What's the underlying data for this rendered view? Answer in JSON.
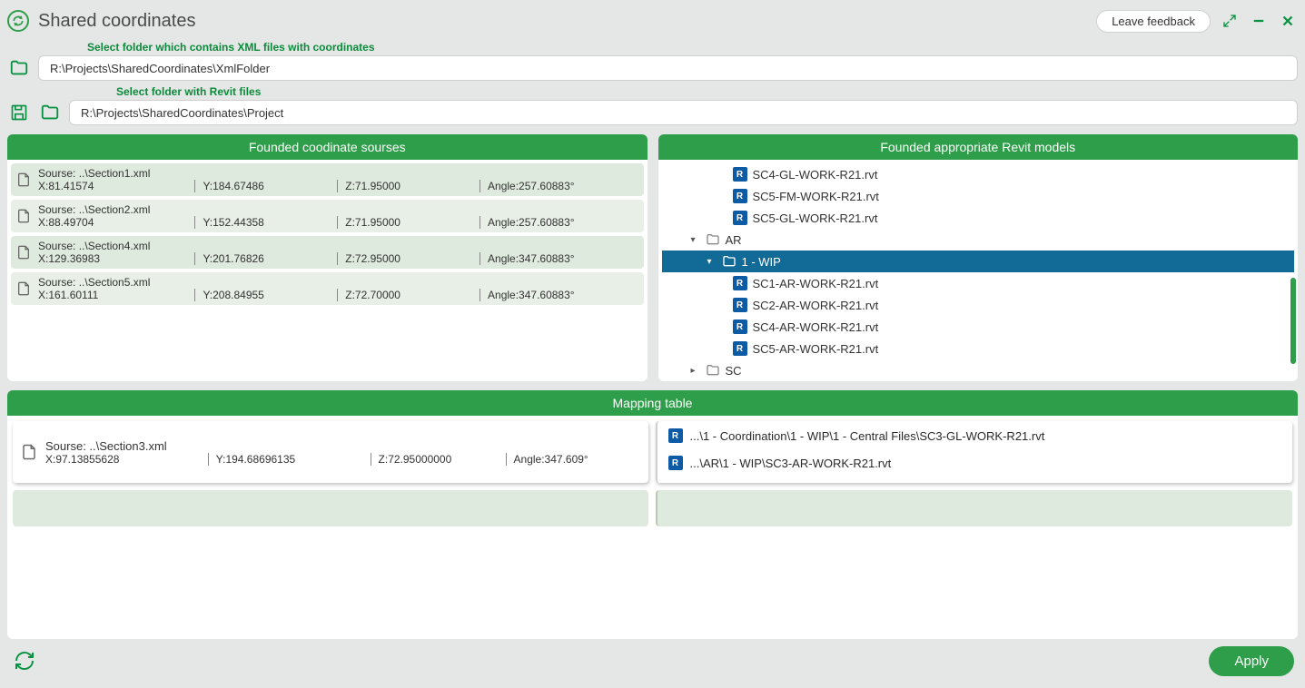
{
  "window": {
    "title": "Shared coordinates",
    "feedback_label": "Leave feedback"
  },
  "folder1": {
    "label": "Select folder which contains XML files with coordinates",
    "value": "R:\\Projects\\SharedCoordinates\\XmlFolder"
  },
  "folder2": {
    "label": "Select folder with Revit files",
    "value": "R:\\Projects\\SharedCoordinates\\Project"
  },
  "panels": {
    "sources_title": "Founded coodinate sourses",
    "models_title": "Founded appropriate Revit models",
    "mapping_title": "Mapping table"
  },
  "sources": [
    {
      "path": "Sourse: ..\\Section1.xml",
      "x": "X:81.41574",
      "y": "Y:184.67486",
      "z": "Z:71.95000",
      "a": "Angle:257.60883°"
    },
    {
      "path": "Sourse: ..\\Section2.xml",
      "x": "X:88.49704",
      "y": "Y:152.44358",
      "z": "Z:71.95000",
      "a": "Angle:257.60883°"
    },
    {
      "path": "Sourse: ..\\Section4.xml",
      "x": "X:129.36983",
      "y": "Y:201.76826",
      "z": "Z:72.95000",
      "a": "Angle:347.60883°"
    },
    {
      "path": "Sourse: ..\\Section5.xml",
      "x": "X:161.60111",
      "y": "Y:208.84955",
      "z": "Z:72.70000",
      "a": "Angle:347.60883°"
    }
  ],
  "tree": {
    "files_top": [
      "SC4-GL-WORK-R21.rvt",
      "SC5-FM-WORK-R21.rvt",
      "SC5-GL-WORK-R21.rvt"
    ],
    "ar_label": "AR",
    "wip_label": "1 - WIP",
    "wip_files": [
      "SC1-AR-WORK-R21.rvt",
      "SC2-AR-WORK-R21.rvt",
      "SC4-AR-WORK-R21.rvt",
      "SC5-AR-WORK-R21.rvt"
    ],
    "sc_label": "SC"
  },
  "mapping": {
    "left": {
      "path": "Sourse: ..\\Section3.xml",
      "x": "X:97.13855628",
      "y": "Y:194.68696135",
      "z": "Z:72.95000000",
      "a": "Angle:347.609°"
    },
    "right": [
      "...\\1 - Coordination\\1 - WIP\\1 - Central Files\\SC3-GL-WORK-R21.rvt",
      "...\\AR\\1 - WIP\\SC3-AR-WORK-R21.rvt"
    ]
  },
  "footer": {
    "apply_label": "Apply"
  }
}
